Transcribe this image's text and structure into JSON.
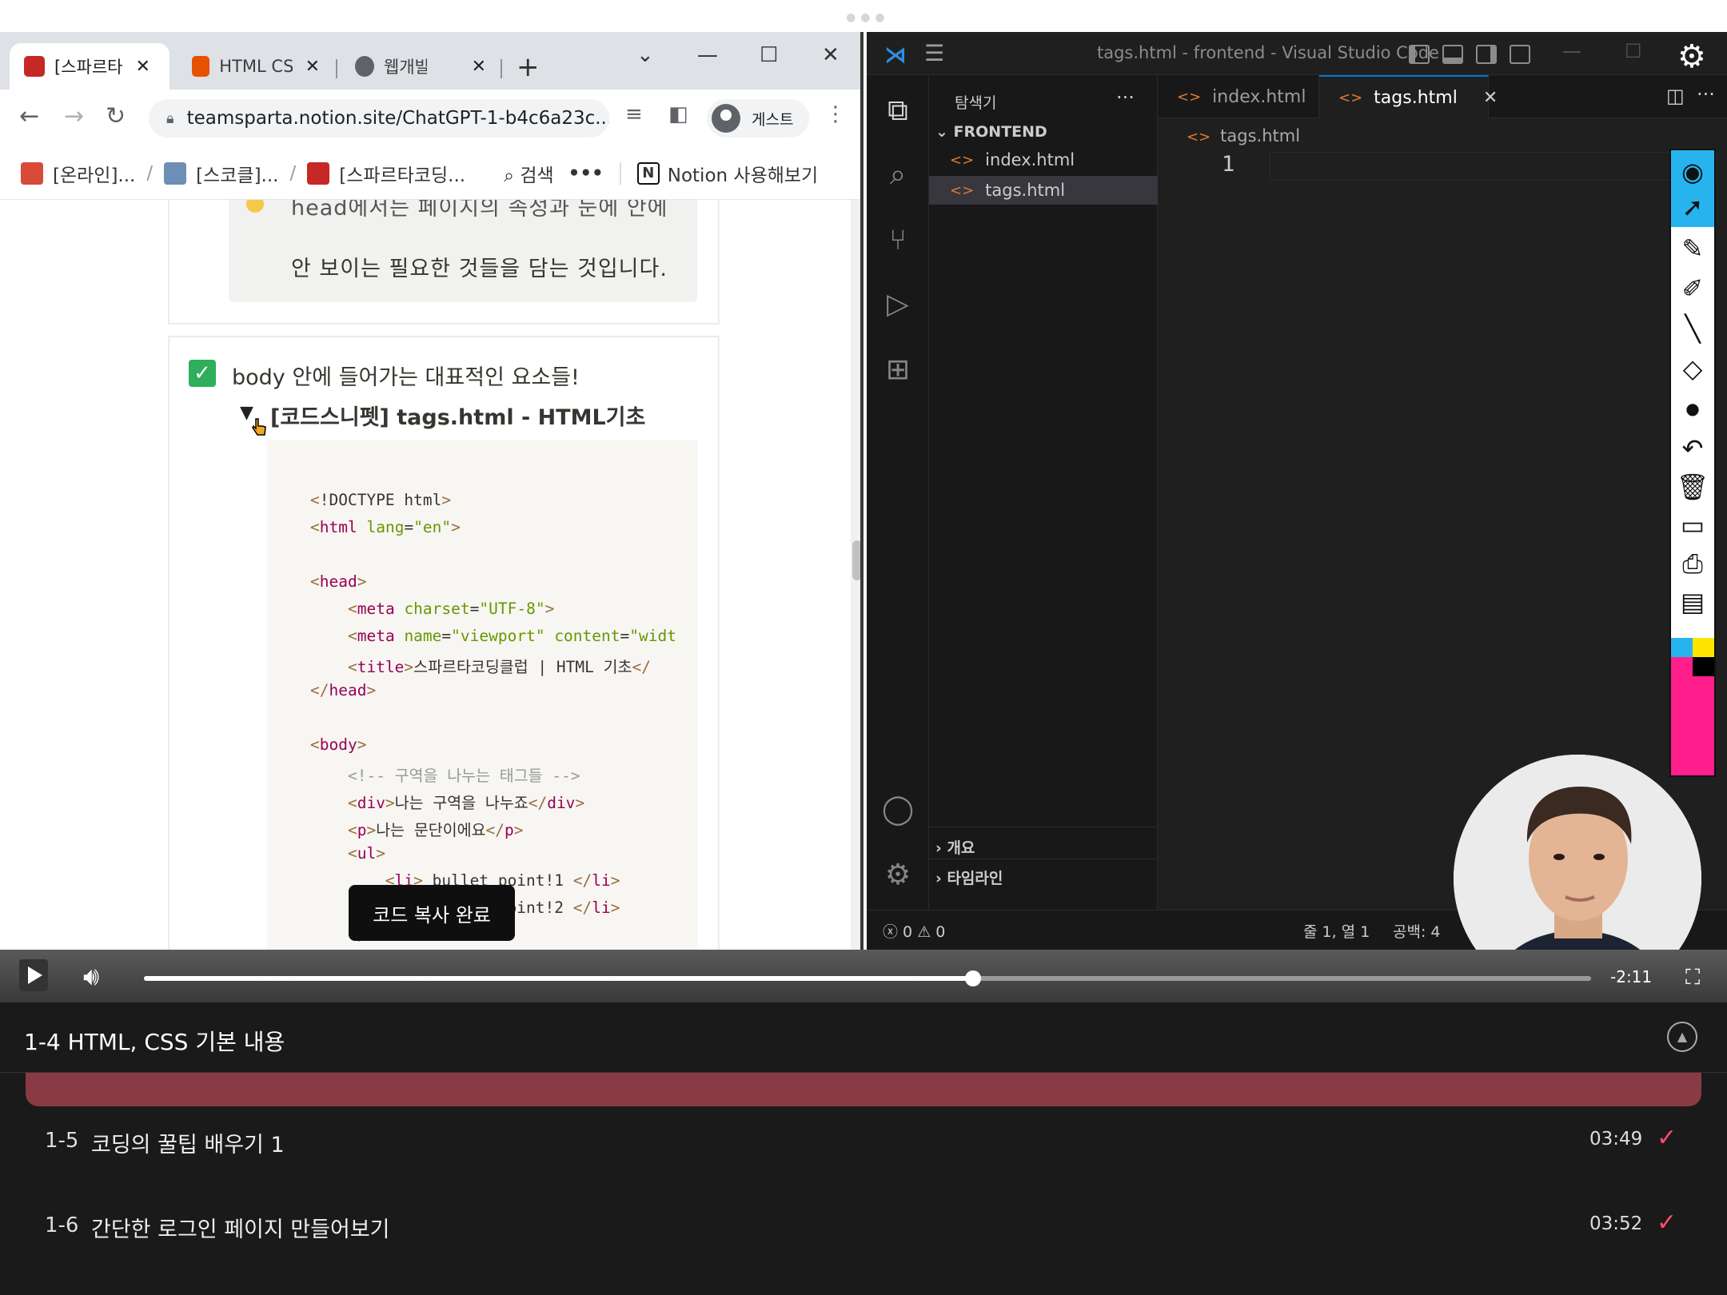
{
  "browser": {
    "tabs": [
      {
        "label": "[스파르타",
        "color": "#c62828"
      },
      {
        "label": "HTML CSS",
        "color": "#e65100"
      },
      {
        "label": "웹개발",
        "color": "#5f6368"
      }
    ],
    "new_tab": "+",
    "url": "teamsparta.notion.site/ChatGPT-1-b4c6a23c...",
    "profile_label": "게스트",
    "notion_breadcrumbs": [
      "[온라인]...",
      "[스코클]...",
      "[스파르타코딩..."
    ],
    "search_label": "검색",
    "more": "•••",
    "notion_cta": "Notion 사용해보기"
  },
  "notion": {
    "callout_line1": "head에서는 페이지의 속성과 눈에 안에",
    "callout_line2": "안 보이는 필요한 것들을 담는 것입니다.",
    "todo_label": "body 안에 들어가는 대표적인 요소들!",
    "toggle_title": "[코드스니펫] tags.html - HTML기초",
    "toast": "코드 복사 완료"
  },
  "vscode": {
    "window_title": "tags.html - frontend - Visual Studio Code",
    "explorer_title": "탐색기",
    "explorer_more": "···",
    "folder": "FRONTEND",
    "files": [
      "index.html",
      "tags.html"
    ],
    "tabs": [
      "index.html",
      "tags.html"
    ],
    "breadcrumb": "tags.html",
    "line_number": "1",
    "outline": "개요",
    "timeline": "타임라인",
    "status_errors": "0",
    "status_warnings": "0",
    "status_position": "줄 1, 열 1",
    "status_spaces": "공백: 4"
  },
  "player": {
    "time_remaining": "-2:11",
    "progress": 0.573
  },
  "course": {
    "current": "1-4  HTML, CSS 기본 내용",
    "lessons": [
      {
        "num": "1-5",
        "name": "코딩의 꿀팁 배우기 1",
        "duration": "03:49"
      },
      {
        "num": "1-6",
        "name": "간단한 로그인 페이지 만들어보기",
        "duration": "03:52"
      }
    ]
  },
  "colors": {
    "accent": "#0078d4",
    "lesson_check": "#ff4d6a",
    "current_lesson_bar": "#8a3a44"
  }
}
